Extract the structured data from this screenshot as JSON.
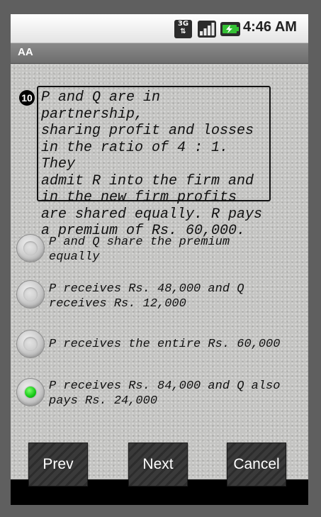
{
  "status_bar": {
    "network": "3G",
    "time": "4:46 AM",
    "icons": [
      "3g-data-icon",
      "signal-strength-icon",
      "battery-charging-icon"
    ]
  },
  "app": {
    "title": "AA"
  },
  "question": {
    "number": "10",
    "lines": [
      "P and Q are in partnership,",
      "sharing profit and losses",
      "in the ratio of 4 : 1. They",
      "admit R into the firm and",
      "in the new firm profits",
      "are shared equally. R pays",
      "a premium of Rs. 60,000."
    ]
  },
  "options": [
    {
      "lines": [
        "P and Q share the premium",
        "equally"
      ],
      "selected": false
    },
    {
      "lines": [
        "P receives Rs. 48,000 and Q",
        "receives Rs. 12,000"
      ],
      "selected": false
    },
    {
      "lines": [
        "P receives the entire Rs. 60,000"
      ],
      "selected": false
    },
    {
      "lines": [
        "P receives Rs. 84,000 and Q also",
        "pays Rs. 24,000"
      ],
      "selected": true
    }
  ],
  "buttons": {
    "prev": "Prev",
    "next": "Next",
    "cancel": "Cancel"
  },
  "colors": {
    "selected_radio": "#15c816",
    "content_bg": "#c4c4c2",
    "titlebar_bg": "#7b7b7b"
  }
}
